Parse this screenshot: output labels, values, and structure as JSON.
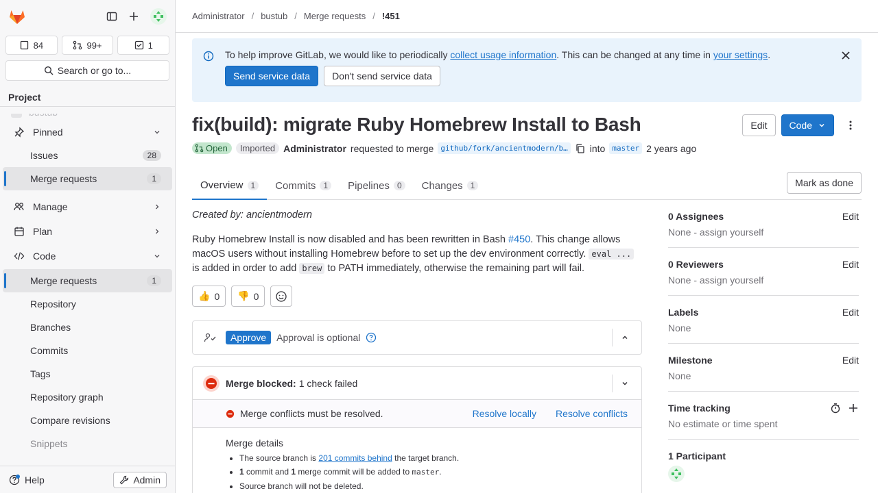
{
  "sidebar": {
    "counts": {
      "issues": "84",
      "merge_requests": "99+",
      "todos": "1"
    },
    "search_label": "Search or go to...",
    "section_title": "Project",
    "faded_project": "bustub",
    "items": [
      {
        "label": "Pinned",
        "icon": "pin-icon"
      },
      {
        "label": "Issues",
        "count": "28"
      },
      {
        "label": "Merge requests",
        "count": "1"
      },
      {
        "label": "Manage",
        "icon": "users-icon"
      },
      {
        "label": "Plan",
        "icon": "calendar-icon"
      },
      {
        "label": "Code",
        "icon": "code-icon"
      },
      {
        "label": "Merge requests",
        "count": "1"
      },
      {
        "label": "Repository"
      },
      {
        "label": "Branches"
      },
      {
        "label": "Commits"
      },
      {
        "label": "Tags"
      },
      {
        "label": "Repository graph"
      },
      {
        "label": "Compare revisions"
      },
      {
        "label": "Snippets"
      }
    ],
    "help": "Help",
    "admin": "Admin"
  },
  "breadcrumb": [
    "Administrator",
    "bustub",
    "Merge requests",
    "!451"
  ],
  "banner": {
    "text1": "To help improve GitLab, we would like to periodically ",
    "link1": "collect usage information",
    "text2": ". This can be changed at any time in ",
    "link2": "your settings",
    "text3": ".",
    "send": "Send service data",
    "dont": "Don't send service data"
  },
  "mr": {
    "title": "fix(build): migrate Ruby Homebrew Install to Bash",
    "edit": "Edit",
    "code": "Code",
    "status": "Open",
    "imported": "Imported",
    "author": "Administrator",
    "requested": "requested to merge",
    "source": "github/fork/ancientmodern/b…",
    "into": "into",
    "target": "master",
    "time": "2 years ago"
  },
  "tabs": [
    {
      "label": "Overview",
      "count": "1"
    },
    {
      "label": "Commits",
      "count": "1"
    },
    {
      "label": "Pipelines",
      "count": "0"
    },
    {
      "label": "Changes",
      "count": "1"
    }
  ],
  "mark_done": "Mark as done",
  "description": {
    "created_by": "Created by: ancientmodern",
    "p1": "Ruby Homebrew Install is now disabled and has been rewritten in Bash ",
    "issue_link": "#450",
    "p2": ". This change allows macOS users without installing Homebrew before to set up the dev environment correctly. ",
    "code1": "eval ...",
    "p3": " is added in order to add ",
    "code2": "brew",
    "p4": " to PATH immediately, otherwise the remaining part will fail."
  },
  "reactions": {
    "thumbsup": "0",
    "thumbsdown": "0"
  },
  "approval": {
    "button": "Approve",
    "text": "Approval is optional"
  },
  "merge": {
    "blocked_label": "Merge blocked:",
    "blocked_text": "1 check failed",
    "conflict": "Merge conflicts must be resolved.",
    "resolve_locally": "Resolve locally",
    "resolve_conflicts": "Resolve conflicts",
    "details_title": "Merge details",
    "d1a": "The source branch is ",
    "d1link": "201 commits behind",
    "d1b": " the target branch.",
    "d2n1": "1",
    "d2a": " commit and ",
    "d2n2": "1",
    "d2b": " merge commit will be added to ",
    "d2code": "master",
    "d2c": ".",
    "d3": "Source branch will not be deleted."
  },
  "right": {
    "assignees": {
      "title": "0 Assignees",
      "edit": "Edit",
      "value": "None - assign yourself"
    },
    "reviewers": {
      "title": "0 Reviewers",
      "edit": "Edit",
      "value": "None - assign yourself"
    },
    "labels": {
      "title": "Labels",
      "edit": "Edit",
      "value": "None"
    },
    "milestone": {
      "title": "Milestone",
      "edit": "Edit",
      "value": "None"
    },
    "time": {
      "title": "Time tracking",
      "value": "No estimate or time spent"
    },
    "participants": {
      "title": "1 Participant"
    }
  },
  "colors": {
    "accent": "#1f75cb",
    "open": "#c3e6cd",
    "danger": "#dd2b0e",
    "banner": "#e9f3fc"
  }
}
